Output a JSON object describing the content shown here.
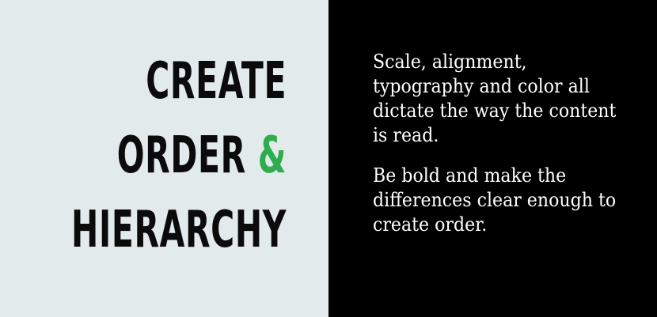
{
  "colors": {
    "left_background": "#E2EAEC",
    "right_background": "#000000",
    "headline_text": "#0B0B0B",
    "accent_green": "#2FAD4E",
    "body_text": "#FFFFFF"
  },
  "headline": {
    "line1": "CREATE",
    "line2_word": "ORDER",
    "line2_ampersand": "&",
    "line3": "HIERARCHY"
  },
  "body": {
    "paragraph1_lines": [
      "Scale, alignment,",
      "typography and color all",
      "dictate the way the content",
      "is read."
    ],
    "paragraph2_lines": [
      "Be bold and make the",
      "differences clear enough to",
      "create order."
    ]
  }
}
